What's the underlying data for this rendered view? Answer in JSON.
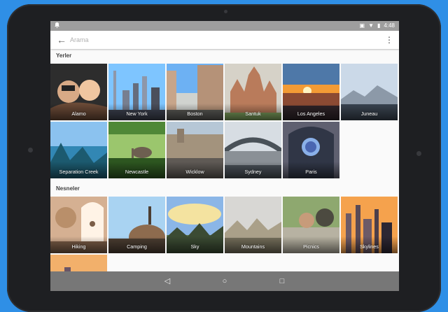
{
  "status": {
    "time": "4:48",
    "icons": [
      "vibrate-icon",
      "wifi-icon",
      "battery-icon"
    ]
  },
  "toolbar": {
    "back_icon": "arrow-left-icon",
    "search_placeholder": "Arama",
    "menu_icon": "more-vert-icon"
  },
  "sections": [
    {
      "title": "Yerler",
      "items": [
        {
          "label": "Alamo",
          "colors": [
            "#f0c6a0",
            "#6b4a37",
            "#2d2d2d"
          ]
        },
        {
          "label": "New York",
          "colors": [
            "#7ec5ff",
            "#8e97a9",
            "#4b4f5c"
          ]
        },
        {
          "label": "Boston",
          "colors": [
            "#6db1f3",
            "#c7a58a",
            "#5a5a56"
          ]
        },
        {
          "label": "Santuk",
          "colors": [
            "#d6d2c8",
            "#b97b5b",
            "#8d6a56"
          ]
        },
        {
          "label": "Los Angeles",
          "colors": [
            "#f39b35",
            "#8b4a33",
            "#2e2327"
          ]
        },
        {
          "label": "Juneau",
          "colors": [
            "#cbd9e8",
            "#8c99a8",
            "#3a4451"
          ]
        },
        {
          "label": "Separation Creek",
          "colors": [
            "#8bc2ef",
            "#3287b4",
            "#1c5a6f"
          ]
        },
        {
          "label": "Newcastle",
          "colors": [
            "#9bc66d",
            "#4f8837",
            "#2d5620"
          ]
        },
        {
          "label": "Wicklow",
          "colors": [
            "#b6c7d6",
            "#a3937d",
            "#5f5a55"
          ]
        },
        {
          "label": "Sydney",
          "colors": [
            "#d7dde3",
            "#8a9096",
            "#495158"
          ]
        },
        {
          "label": "Paris",
          "colors": [
            "#5f6070",
            "#303646",
            "#1c2030"
          ]
        }
      ]
    },
    {
      "title": "Nesneler",
      "items": [
        {
          "label": "Hiking",
          "colors": [
            "#d5b092",
            "#fff3e6",
            "#7b5d47"
          ]
        },
        {
          "label": "Camping",
          "colors": [
            "#a9d3f2",
            "#8d6b4e",
            "#4c3e32"
          ]
        },
        {
          "label": "Sky",
          "colors": [
            "#8bb6e7",
            "#f4e3a0",
            "#5f7a4a"
          ]
        },
        {
          "label": "Mountains",
          "colors": [
            "#d8d7d4",
            "#aaa089",
            "#756f5b"
          ]
        },
        {
          "label": "Picnics",
          "colors": [
            "#8ea86f",
            "#b7b2a2",
            "#4c4a40"
          ]
        },
        {
          "label": "Skylines",
          "colors": [
            "#f5a24d",
            "#6d5a67",
            "#2d2733"
          ]
        },
        {
          "label": "",
          "colors": [
            "#f2b06b",
            "#8a6d7f",
            "#3d3645"
          ]
        }
      ]
    }
  ],
  "nav": {
    "back_icon": "nav-back-icon",
    "home_icon": "nav-home-icon",
    "recents_icon": "nav-recents-icon"
  }
}
